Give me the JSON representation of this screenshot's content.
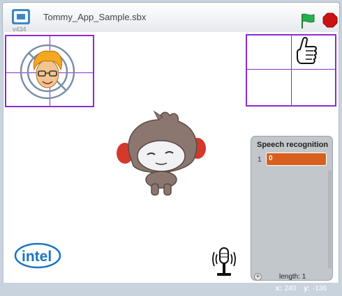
{
  "window": {
    "title": "Tommy_App_Sample.sbx",
    "version": "v434"
  },
  "controls": {
    "flag_icon": "green-flag-icon",
    "stop_icon": "stop-sign-icon",
    "flag_color": "#22b14c",
    "stop_color": "#cc1111"
  },
  "stage": {
    "list_monitor": {
      "title": "Speech recognition",
      "items": [
        {
          "index": "1",
          "value": "0"
        }
      ],
      "length_label": "length: 1",
      "add_label": "+"
    },
    "logo_text": "intel"
  },
  "status": {
    "x_label": "x:",
    "x_value": "240",
    "y_label": "y:",
    "y_value": "-136"
  },
  "colors": {
    "tracking_box": "#8b2bd1",
    "list_item": "#d8601e",
    "intel_blue": "#1a73c7"
  }
}
